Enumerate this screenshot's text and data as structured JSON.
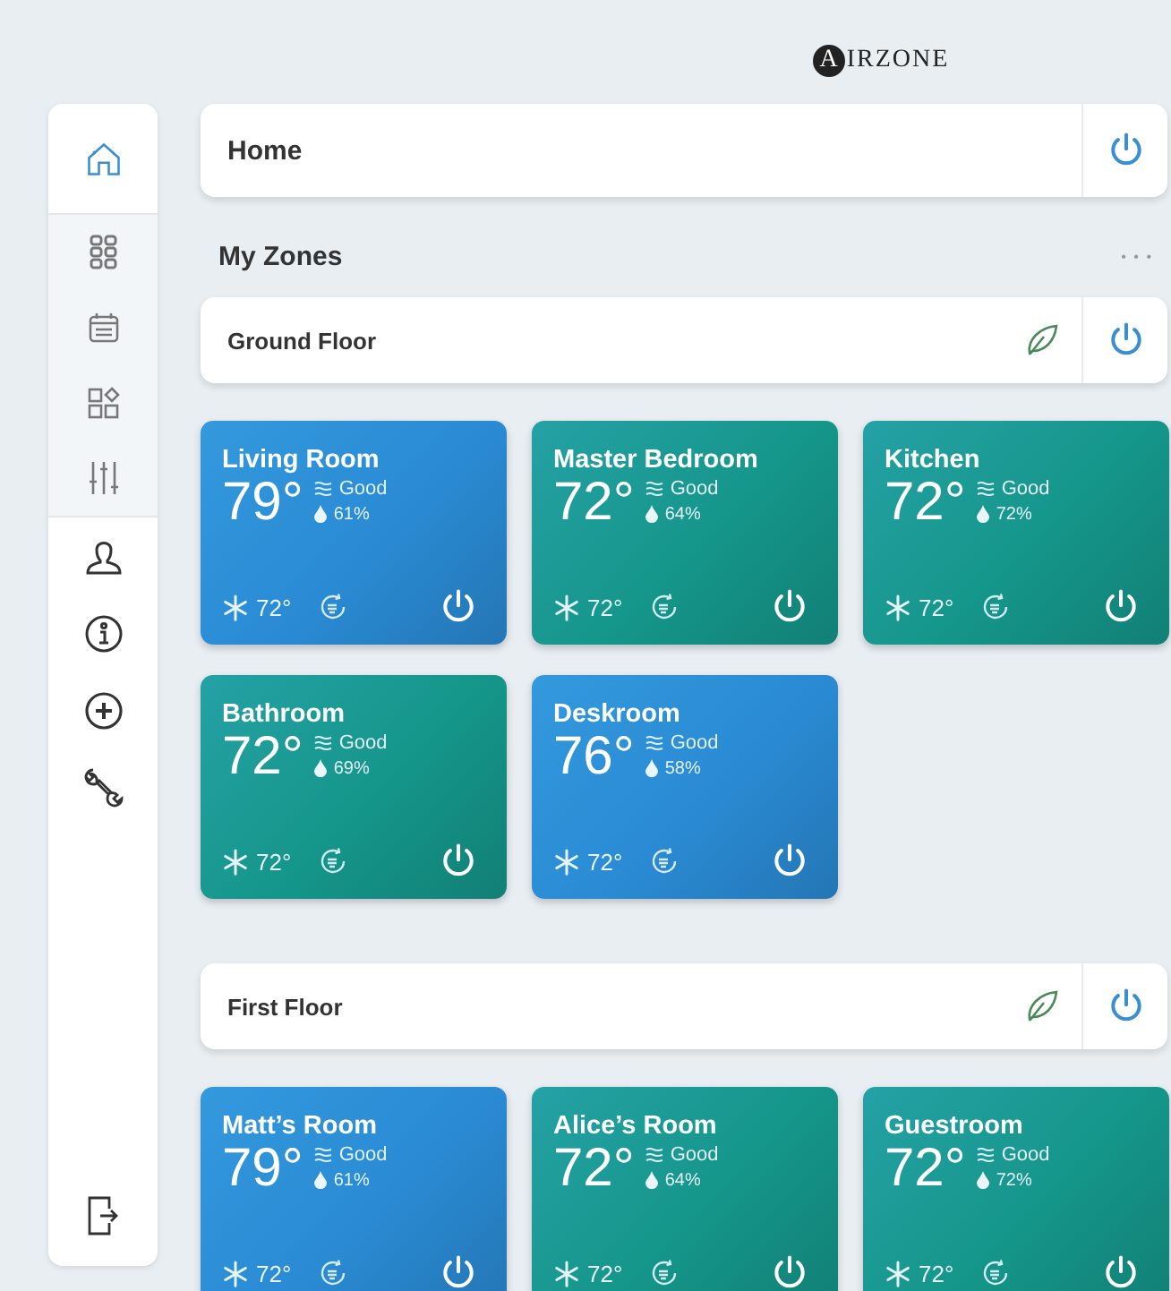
{
  "logo": {
    "mark": "A",
    "text": "IRZONE"
  },
  "sidebar": {
    "top_items": [
      {
        "selected": true
      },
      {
        "selected": false
      },
      {
        "selected": false
      },
      {
        "selected": false
      },
      {
        "selected": false
      }
    ],
    "bottom_items": [
      {
        "selected": false
      },
      {
        "selected": false
      },
      {
        "selected": false
      },
      {
        "selected": false
      }
    ]
  },
  "home_bar": {
    "title": "Home"
  },
  "section": {
    "title": "My Zones",
    "menu": "• • •"
  },
  "floors": [
    {
      "name": "Ground Floor",
      "zones": [
        {
          "name": "Living Room",
          "temp": "79°",
          "air": "Good",
          "humidity": "61%",
          "setpoint": "72°",
          "color": "#2a8bd4"
        },
        {
          "name": "Master Bedroom",
          "temp": "72°",
          "air": "Good",
          "humidity": "64%",
          "setpoint": "72°",
          "color": "#15968a"
        },
        {
          "name": "Kitchen",
          "temp": "72°",
          "air": "Good",
          "humidity": "72%",
          "setpoint": "72°",
          "color": "#15968a"
        },
        {
          "name": "Bathroom",
          "temp": "72°",
          "air": "Good",
          "humidity": "69%",
          "setpoint": "72°",
          "color": "#15968a"
        },
        {
          "name": "Deskroom",
          "temp": "76°",
          "air": "Good",
          "humidity": "58%",
          "setpoint": "72°",
          "color": "#2a8bd4"
        }
      ]
    },
    {
      "name": "First Floor",
      "zones": [
        {
          "name": "Matt’s Room",
          "temp": "79°",
          "air": "Good",
          "humidity": "61%",
          "setpoint": "72°",
          "color": "#2a8bd4"
        },
        {
          "name": "Alice’s Room",
          "temp": "72°",
          "air": "Good",
          "humidity": "64%",
          "setpoint": "72°",
          "color": "#15968a"
        },
        {
          "name": "Guestroom",
          "temp": "72°",
          "air": "Good",
          "humidity": "72%",
          "setpoint": "72°",
          "color": "#15968a"
        }
      ]
    }
  ]
}
